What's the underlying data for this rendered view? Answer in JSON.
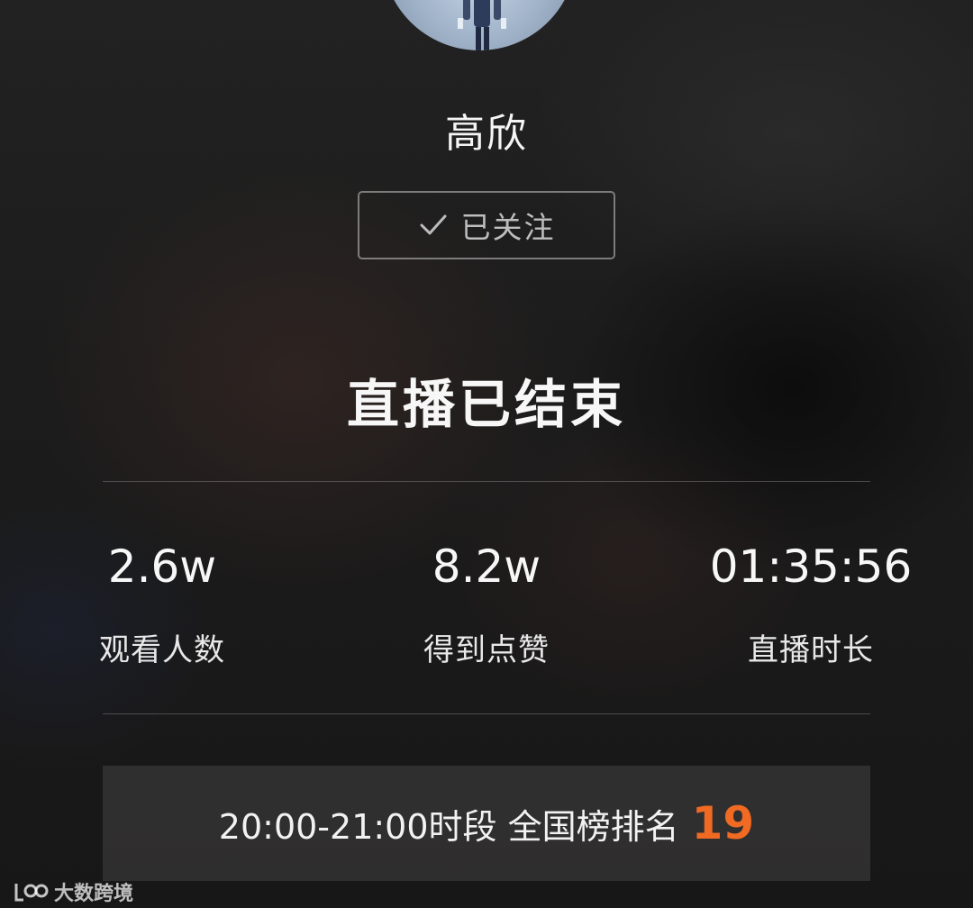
{
  "profile": {
    "name": "高欣",
    "follow_label": "已关注"
  },
  "live": {
    "status_title": "直播已结束",
    "stats": [
      {
        "value": "2.6w",
        "label": "观看人数"
      },
      {
        "value": "8.2w",
        "label": "得到点赞"
      },
      {
        "value": "01:35:56",
        "label": "直播时长"
      }
    ],
    "ranking": {
      "text": "20:00-21:00时段 全国榜排名",
      "rank": "19",
      "rank_color": "#f06a23"
    }
  },
  "watermark": {
    "text": "大数跨境",
    "icon": "brand-logo-icon"
  }
}
